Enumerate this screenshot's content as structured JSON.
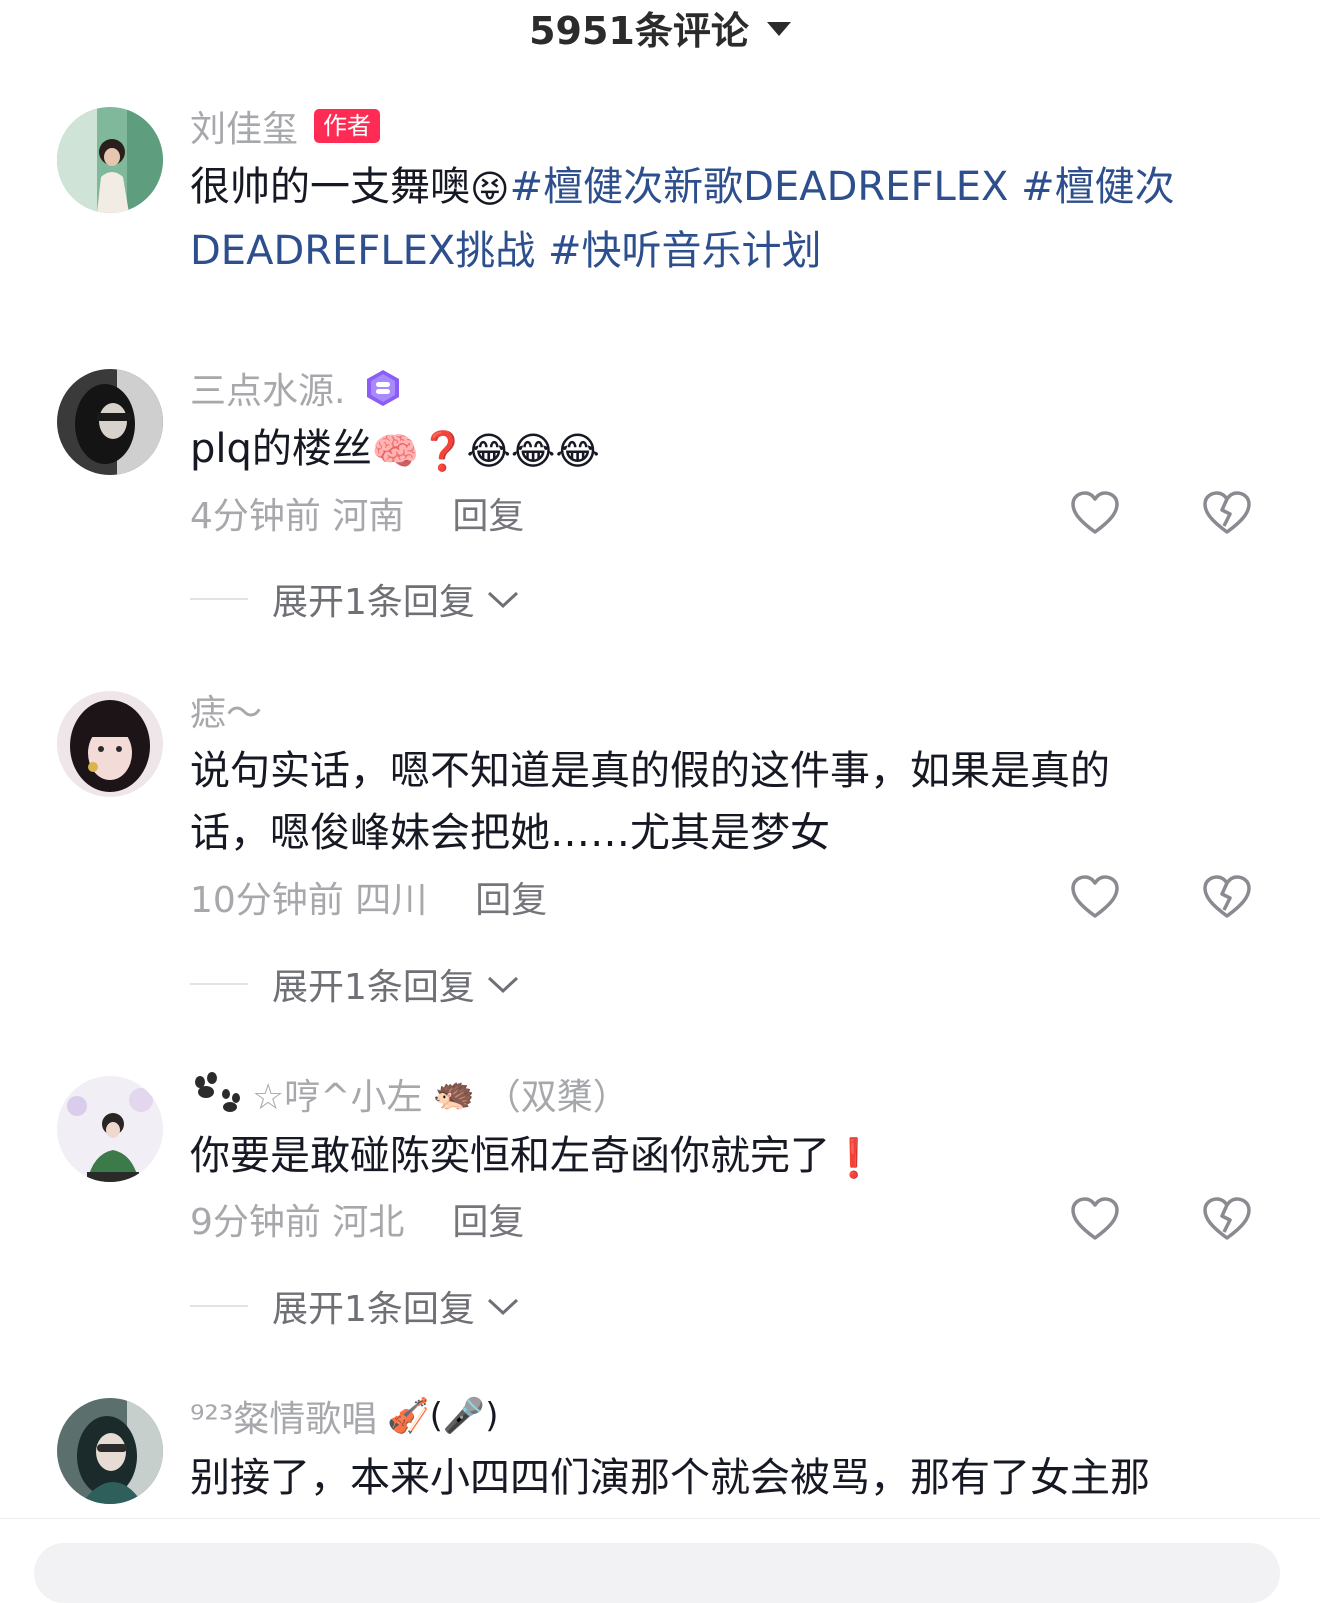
{
  "header": {
    "count_title": "5951条评论"
  },
  "comments": [
    {
      "username": "刘佳玺",
      "badge": "作者",
      "text": "很帅的一支舞噢",
      "emoji": "😝",
      "hashtags_line1": "#檀健次新歌DEADREFLEX #檀健次",
      "hashtags_line2": "DEADREFLEX挑战 #快听音乐计划"
    },
    {
      "username": "三点水源.",
      "text": "plq的楼丝",
      "emojis": "🧠❓😂😂😂",
      "time_location": "4分钟前 河南",
      "reply_label": "回复",
      "expand_label": "展开1条回复"
    },
    {
      "username": "痣～",
      "text_line1": "说句实话，嗯不知道是真的假的这件事，如果是真的",
      "text_line2": "话，嗯俊峰妹会把她……尤其是梦女",
      "time_location": "10分钟前 四川",
      "reply_label": "回复",
      "expand_label": "展开1条回复"
    },
    {
      "username": "☆哼^小左",
      "name_emoji": "🦔",
      "name_suffix": "（双橥）",
      "text": "你要是敢碰陈奕恒和左奇函你就完了",
      "emoji": "❗",
      "time_location": "9分钟前 河北",
      "reply_label": "回复",
      "expand_label": "展开1条回复"
    },
    {
      "username": "⁹²³粲情歌唱",
      "name_emojis": "🎻(🎤)",
      "text": "别接了，本来小四四们演那个就会被骂，那有了女主那"
    }
  ],
  "colors": {
    "hashtag": "#2d4f8e",
    "author_badge": "#fe2c55",
    "vip_badge": "#8b5cf6",
    "meta_gray": "#a7a8ac"
  },
  "icons": [
    "caret-down-icon",
    "heart-icon",
    "broken-heart-icon",
    "vip-badge-icon",
    "paw-icon",
    "chevron-down-icon"
  ]
}
